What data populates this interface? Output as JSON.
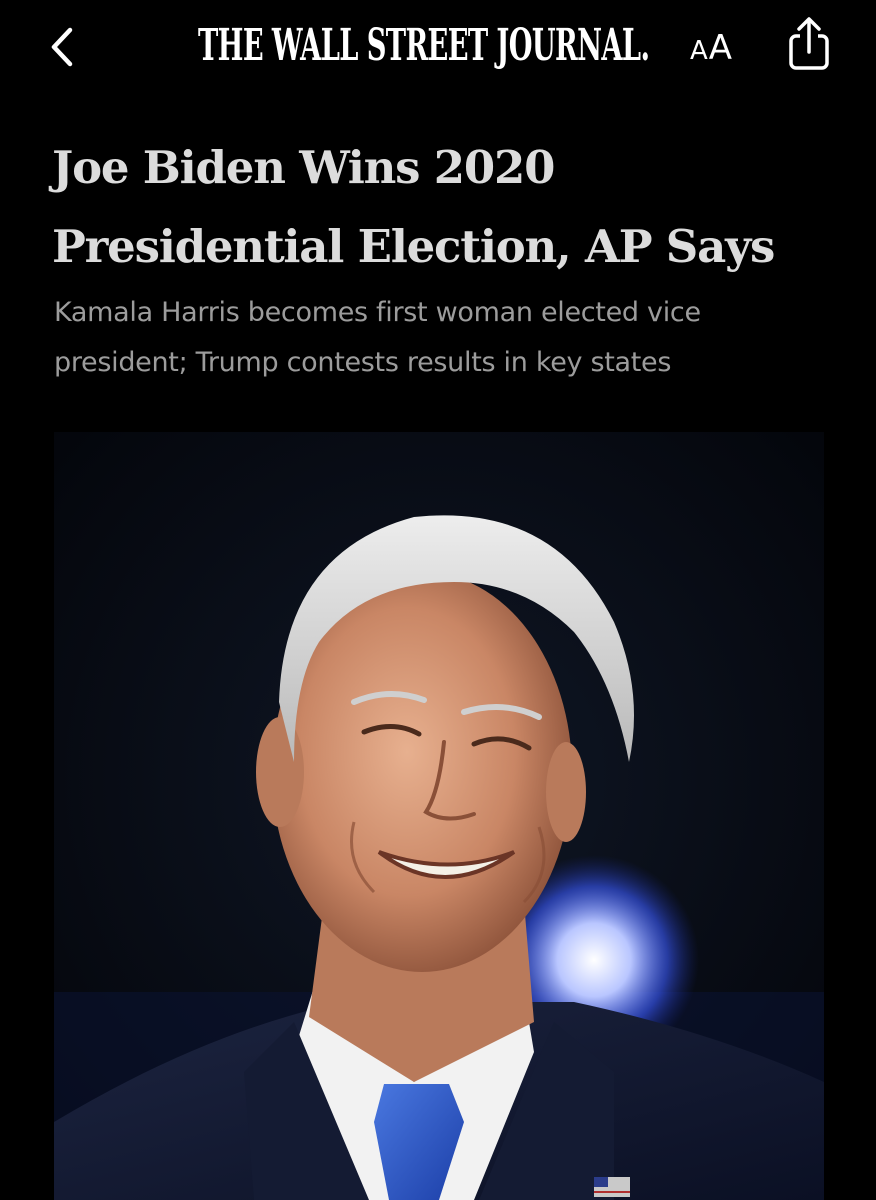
{
  "header": {
    "back_icon": "chevron-left-icon",
    "masthead": "THE WALL STREET JOURNAL.",
    "text_size_small": "A",
    "text_size_large": "A",
    "share_icon": "share-icon"
  },
  "article": {
    "headline_line1": "Joe Biden Wins 2020",
    "headline_line2": "Presidential Election, AP Says",
    "dek_line1": "Kamala Harris becomes first woman elected vice",
    "dek_line2": "president; Trump contests results in key states"
  },
  "colors": {
    "background": "#000000",
    "headline": "#dcdcdc",
    "dek": "#9c9c9c",
    "photo_light": "#3b5bff"
  }
}
